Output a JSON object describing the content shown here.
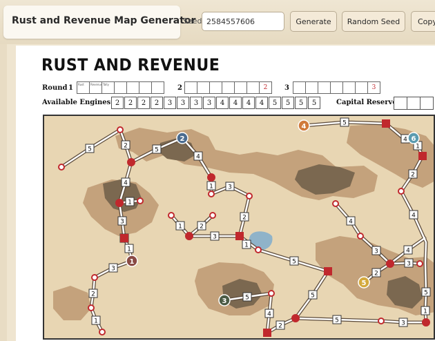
{
  "app": {
    "title": "Rust and Revenue Map Generator",
    "seed_label": "Seed",
    "seed_value": "2584557606",
    "generate_label": "Generate",
    "random_seed_label": "Random Seed",
    "copy_label": "Copy"
  },
  "sheet": {
    "title": "RUST AND REVENUE",
    "round_label": "Round",
    "rounds": [
      {
        "number": "1",
        "cells": [
          "",
          "",
          "",
          "",
          "",
          "",
          ""
        ],
        "headers": [
          "Rust",
          "Revenue",
          "Tally"
        ],
        "last": ""
      },
      {
        "number": "2",
        "cells": [
          "",
          "",
          "",
          "",
          "",
          ""
        ],
        "last": "2"
      },
      {
        "number": "3",
        "cells": [
          "",
          "",
          "",
          "",
          "",
          "",
          ""
        ],
        "last": "3"
      }
    ],
    "engines_label": "Available Engines",
    "engines": [
      "2",
      "2",
      "2",
      "2",
      "3",
      "3",
      "3",
      "3",
      "4",
      "4",
      "4",
      "4",
      "5",
      "5",
      "5",
      "5"
    ],
    "capital_label": "Capital Reserve"
  },
  "map": {
    "colors": {
      "land_light": "#e8d6b3",
      "land_mid": "#c4a27c",
      "land_dark": "#7b6850",
      "water": "#8fb3c9",
      "track": "#ffffff",
      "station": "#c0282d"
    },
    "track_labels": [
      "5",
      "2",
      "5",
      "2",
      "4",
      "4",
      "1",
      "3",
      "1",
      "1",
      "3",
      "2",
      "1",
      "2",
      "3",
      "1",
      "1",
      "3",
      "1",
      "2",
      "2",
      "1",
      "5",
      "4",
      "5",
      "1",
      "2",
      "4",
      "4",
      "3",
      "4",
      "3",
      "2",
      "5",
      "5",
      "4",
      "2",
      "5",
      "3",
      "1",
      "5",
      "3",
      "1",
      "5"
    ],
    "cities": [
      {
        "label": "1",
        "color": "#8a4a44"
      },
      {
        "label": "2",
        "color": "#4a6b8f"
      },
      {
        "label": "3",
        "color": "#4a5a44"
      },
      {
        "label": "4",
        "color": "#d07a3c"
      },
      {
        "label": "5",
        "color": "#d4a93c"
      },
      {
        "label": "6",
        "color": "#5a9bb0"
      }
    ]
  }
}
